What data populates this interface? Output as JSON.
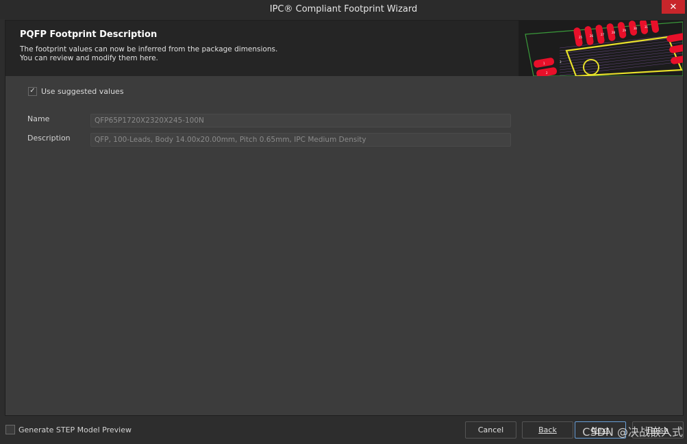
{
  "window": {
    "title": "IPC® Compliant Footprint Wizard",
    "close_glyph": "✕"
  },
  "banner": {
    "heading": "PQFP Footprint Description",
    "line1": "The footprint values can now be inferred from the package dimensions.",
    "line2": "You can review and modify them here.",
    "pad_labels": [
      "1",
      "2",
      "3",
      "25",
      "26",
      "27",
      "28",
      "29",
      "30",
      "31"
    ]
  },
  "options": {
    "use_suggested_label": "Use suggested values",
    "use_suggested_checked": true,
    "check_glyph": "✓"
  },
  "fields": {
    "name_label": "Name",
    "name_value": "QFP65P1720X2320X245-100N",
    "description_label": "Description",
    "description_value": "QFP, 100-Leads, Body 14.00x20.00mm, Pitch 0.65mm, IPC Medium Density"
  },
  "footer": {
    "step_preview_label": "Generate STEP Model Preview",
    "step_preview_checked": false,
    "cancel_label": "Cancel",
    "back_label": "Back",
    "next_label": "Next",
    "finish_label": "Finish"
  },
  "watermark": "CSDN @决战嵌入式",
  "colors": {
    "pad_red": "#e8102a",
    "silkscreen_yellow": "#e8e02a",
    "board_outline_green": "#3a9a3a",
    "close_red": "#c8262b"
  }
}
